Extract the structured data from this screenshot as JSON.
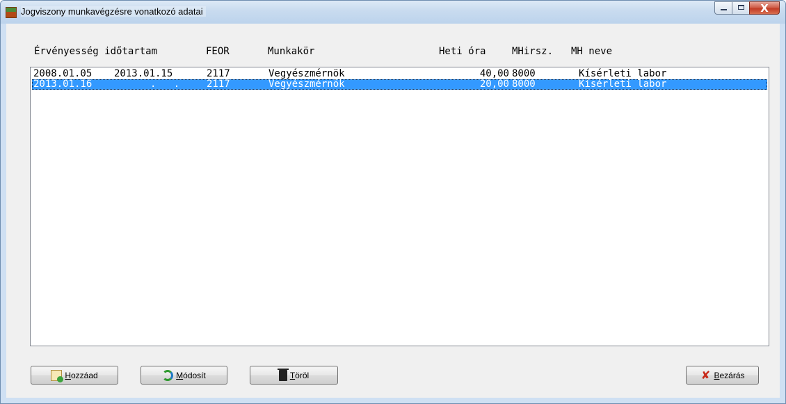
{
  "window": {
    "title": "Jogviszony munkavégzésre vonatkozó adatai",
    "close_glyph": "X"
  },
  "columns": {
    "validity": "Érvényesség időtartam",
    "feor": "FEOR",
    "job": "Munkakör",
    "hours": "Heti óra",
    "mh_no": "MHirsz.",
    "mh_name": "MH neve"
  },
  "rows": [
    {
      "from": "2008.01.05",
      "to": "2013.01.15",
      "feor": "2117",
      "job": "Vegyészmérnök",
      "hours": "40,00",
      "mh_no": "8000",
      "mh_name": "Kísérleti labor",
      "selected": false
    },
    {
      "from": "2013.01.16",
      "to": ".   .",
      "feor": "2117",
      "job": "Vegyészmérnök",
      "hours": "20,00",
      "mh_no": "8000",
      "mh_name": "Kísérleti labor",
      "selected": true
    }
  ],
  "buttons": {
    "add": {
      "accel": "H",
      "rest": "ozzáad",
      "icon": "add-document-icon"
    },
    "modify": {
      "accel": "M",
      "rest": "ódosít",
      "icon": "refresh-icon"
    },
    "delete": {
      "accel": "T",
      "rest": "öröl",
      "icon": "trash-icon"
    },
    "close": {
      "accel": "B",
      "rest": "ezárás",
      "icon": "red-x-icon",
      "glyph": "✘"
    }
  },
  "colors": {
    "selection": "#3399ff",
    "titlebar": "#c8dbef",
    "close_button": "#c23c26"
  }
}
